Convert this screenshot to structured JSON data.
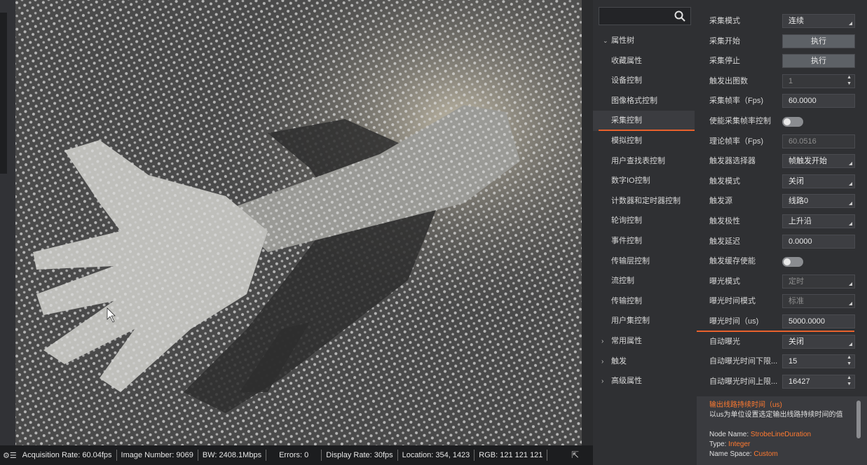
{
  "left_marker": "",
  "statusbar": {
    "acquisition": "Acquisition Rate: 60.04fps",
    "image_number": "Image Number: 9069",
    "bw": "BW: 2408.1Mbps",
    "errors": "Errors: 0",
    "display_rate": "Display Rate: 30fps",
    "location": "Location: 354, 1423",
    "rgb": "RGB: 121 121 121",
    "expand_icon": "⇱"
  },
  "search": {
    "placeholder": ""
  },
  "tree": {
    "root_label": "属性树",
    "items": [
      "收藏属性",
      "设备控制",
      "图像格式控制",
      "采集控制",
      "模拟控制",
      "用户查找表控制",
      "数字IO控制",
      "计数器和定时器控制",
      "轮询控制",
      "事件控制",
      "传输层控制",
      "流控制",
      "传输控制",
      "用户集控制"
    ],
    "selected_index": 3,
    "groups": [
      "常用属性",
      "触发",
      "高级属性"
    ]
  },
  "props": [
    {
      "label": "采集模式",
      "value": "连续",
      "kind": "combo"
    },
    {
      "label": "采集开始",
      "value": "执行",
      "kind": "button"
    },
    {
      "label": "采集停止",
      "value": "执行",
      "kind": "button"
    },
    {
      "label": "触发出图数",
      "value": "1",
      "kind": "spin-dim"
    },
    {
      "label": "采集帧率（Fps)",
      "value": "60.0000",
      "kind": "text"
    },
    {
      "label": "使能采集帧率控制",
      "value": "",
      "kind": "toggle"
    },
    {
      "label": "理论帧率（Fps)",
      "value": "60.0516",
      "kind": "text-dim"
    },
    {
      "label": "触发器选择器",
      "value": "帧触发开始",
      "kind": "combo"
    },
    {
      "label": "触发模式",
      "value": "关闭",
      "kind": "combo"
    },
    {
      "label": "触发源",
      "value": "线路0",
      "kind": "combo"
    },
    {
      "label": "触发极性",
      "value": "上升沿",
      "kind": "combo"
    },
    {
      "label": "触发延迟",
      "value": "0.0000",
      "kind": "text"
    },
    {
      "label": "触发缓存使能",
      "value": "",
      "kind": "toggle"
    },
    {
      "label": "曝光模式",
      "value": "定时",
      "kind": "combo-dim"
    },
    {
      "label": "曝光时间模式",
      "value": "标准",
      "kind": "combo-dim"
    },
    {
      "label": "曝光时间（us)",
      "value": "5000.0000",
      "kind": "text-highlight"
    },
    {
      "label": "自动曝光",
      "value": "关闭",
      "kind": "combo"
    },
    {
      "label": "自动曝光时间下限...",
      "value": "15",
      "kind": "spin"
    },
    {
      "label": "自动曝光时间上限...",
      "value": "16427",
      "kind": "spin"
    }
  ],
  "description": {
    "title": "输出线路持续时间（us)",
    "text": "以us为单位设置选定输出线路持续时间的值",
    "node_name_label": "Node Name: ",
    "node_name": "StrobeLineDuration",
    "type_label": "Type: ",
    "type": "Integer",
    "namespace_label": "Name Space: ",
    "namespace": "Custom"
  },
  "colors": {
    "accent": "#e8612c",
    "highlight_text": "#ff7a30"
  }
}
